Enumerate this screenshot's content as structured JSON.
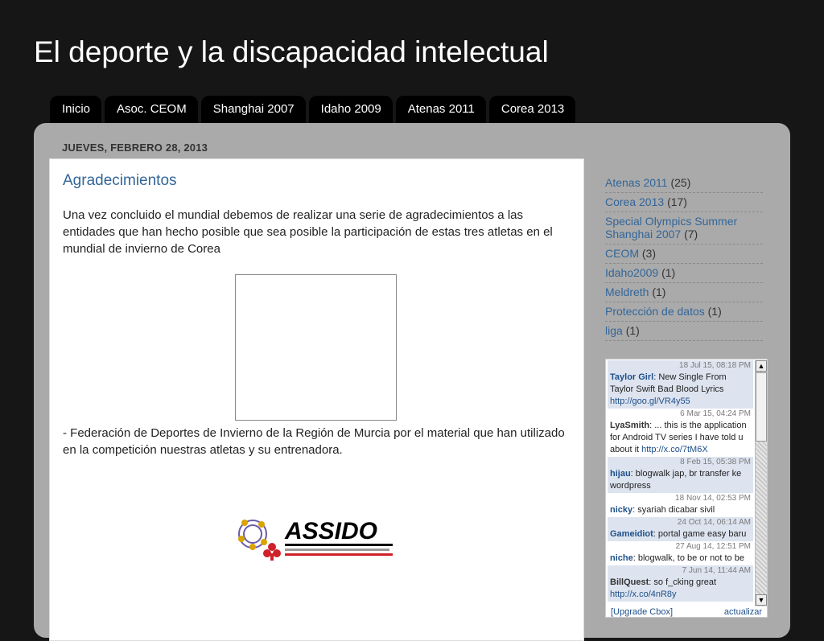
{
  "header": {
    "title": "El deporte y la discapacidad intelectual"
  },
  "tabs": [
    "Inicio",
    "Asoc. CEOM",
    "Shanghai 2007",
    "Idaho 2009",
    "Atenas 2011",
    "Corea 2013"
  ],
  "post": {
    "date": "JUEVES, FEBRERO 28, 2013",
    "title": "Agradecimientos",
    "intro": "Una vez concluido el mundial debemos de realizar una serie de agradecimientos a las entidades que han hecho posible que sea posible la participación de estas tres atletas en el mundial de invierno de Corea",
    "paragraph1": "- Federación de Deportes de Invierno de la Región de Murcia por el material que han utilizado en la competición nuestras atletas y su entrenadora.",
    "logo_text": "ASSIDO"
  },
  "labels": [
    {
      "name": "Atenas 2011",
      "count": "(25)"
    },
    {
      "name": "Corea 2013",
      "count": "(17)"
    },
    {
      "name": "Special Olympics Summer Shanghai 2007",
      "count": "(7)"
    },
    {
      "name": "CEOM",
      "count": "(3)"
    },
    {
      "name": "Idaho2009",
      "count": "(1)"
    },
    {
      "name": "Meldreth",
      "count": "(1)"
    },
    {
      "name": "Protección de datos",
      "count": "(1)"
    },
    {
      "name": "liga",
      "count": "(1)"
    }
  ],
  "cbox": {
    "messages": [
      {
        "time": "18 Jul 15, 08:18 PM",
        "name": "Taylor Girl",
        "text": ": New Single From Taylor Swift Bad Blood Lyrics ",
        "link": "http://goo.gl/VR4y55"
      },
      {
        "time": "6 Mar 15, 04:24 PM",
        "name": "LyaSmith",
        "text": ": ... this is the application for Android TV series I have told u about it ",
        "link": "http://x.co/7tM6X"
      },
      {
        "time": "8 Feb 15, 05:38 PM",
        "name": "hijau",
        "text": ": blogwalk jap, br transfer ke wordpress",
        "link": ""
      },
      {
        "time": "18 Nov 14, 02:53 PM",
        "name": "nicky",
        "text": ": syariah dicabar sivil",
        "link": ""
      },
      {
        "time": "24 Oct 14, 06:14 AM",
        "name": "Gameidiot",
        "text": ": portal game easy baru",
        "link": ""
      },
      {
        "time": "27 Aug 14, 12:51 PM",
        "name": "niche",
        "text": ": blogwalk, to be or not to be",
        "link": ""
      },
      {
        "time": "7 Jun 14, 11:44 AM",
        "name": "BillQuest",
        "text": ": so f_cking great ",
        "link": "http://x.co/4nR8y"
      }
    ],
    "footer_left": "[Upgrade Cbox]",
    "footer_right": "actualizar"
  }
}
